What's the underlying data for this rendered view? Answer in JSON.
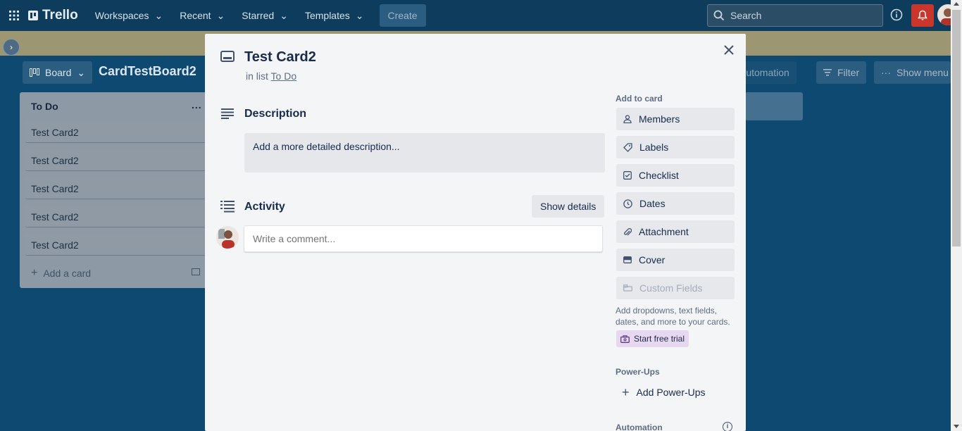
{
  "topnav": {
    "logo": "Trello",
    "menus": [
      "Workspaces",
      "Recent",
      "Starred",
      "Templates"
    ],
    "create": "Create",
    "search_placeholder": "Search"
  },
  "board": {
    "view_label": "Board",
    "name": "CardTestBoard2",
    "automation": "Automation",
    "filter": "Filter",
    "show_menu": "Show menu"
  },
  "list": {
    "title": "To Do",
    "more": "...",
    "cards": [
      "Test Card2",
      "Test Card2",
      "Test Card2",
      "Test Card2",
      "Test Card2"
    ],
    "add_card": "Add a card"
  },
  "modal": {
    "title": "Test Card2",
    "in_list_prefix": "in list",
    "in_list_name": "To Do",
    "description_heading": "Description",
    "description_placeholder": "Add a more detailed description...",
    "activity_heading": "Activity",
    "show_details": "Show details",
    "comment_placeholder": "Write a comment...",
    "sidebar": {
      "add_to_card": "Add to card",
      "buttons": [
        "Members",
        "Labels",
        "Checklist",
        "Dates",
        "Attachment",
        "Cover",
        "Custom Fields"
      ],
      "custom_fields_note": "Add dropdowns, text fields, dates, and more to your cards.",
      "start_trial": "Start free trial",
      "powerups_heading": "Power-Ups",
      "add_powerups": "Add Power-Ups",
      "automation_heading": "Automation"
    }
  },
  "colors": {
    "nav": "#0d3c5c",
    "board_bg": "#0d4971",
    "banner": "#9c9772",
    "modal_bg": "#f4f5f7",
    "notification": "#c9372c"
  }
}
